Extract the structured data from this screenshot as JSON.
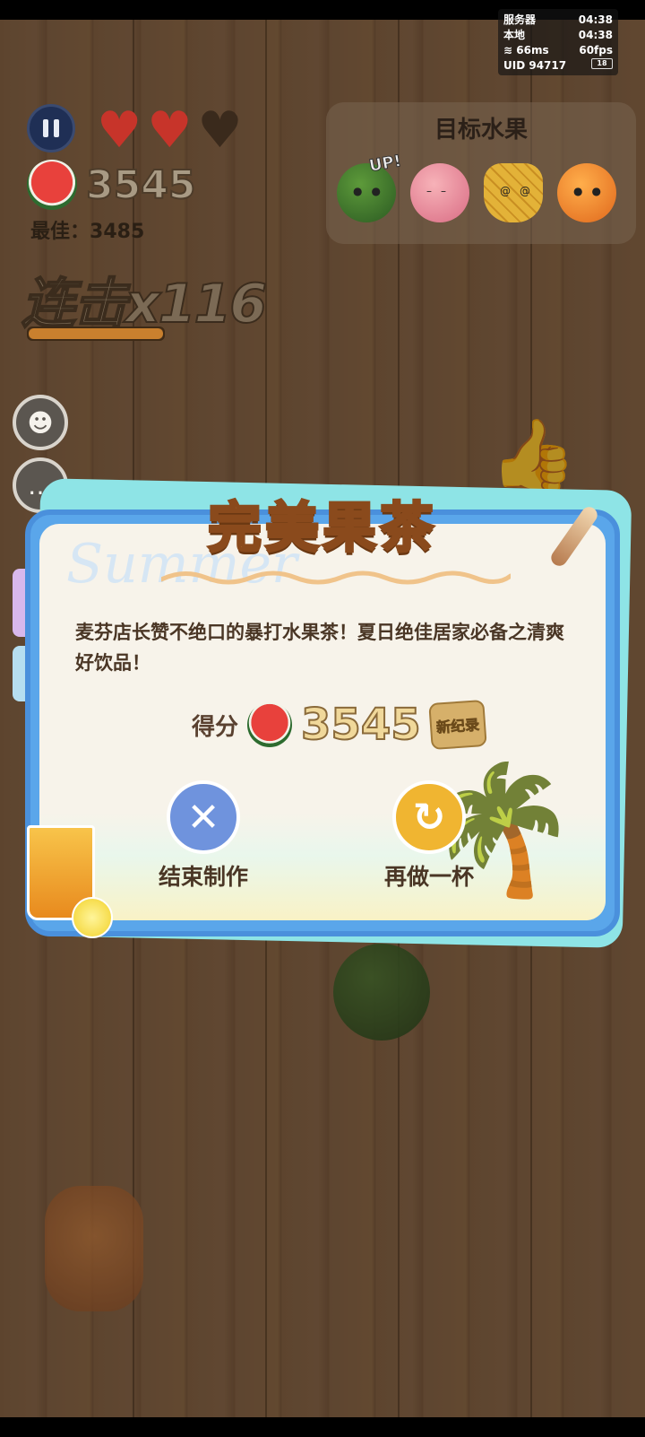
{
  "hud": {
    "server_label": "服务器",
    "server_time": "04:38",
    "local_label": "本地",
    "local_time": "04:38",
    "ping": "66ms",
    "fps": "60fps",
    "uid_label": "UID",
    "uid": "94717",
    "battery": "18"
  },
  "game": {
    "lives_total": 3,
    "lives_remaining": 2,
    "score": "3545",
    "best_label": "最佳：",
    "best": "3485",
    "combo": "连击x116",
    "combo_progress": 1.0
  },
  "target": {
    "title": "目标水果",
    "up_tag": "UP!",
    "fruits": [
      "watermelon",
      "peach",
      "pineapple",
      "orange"
    ]
  },
  "modal": {
    "title": "完美果茶",
    "decor_text": "Summer",
    "description": "麦芬店长赞不绝口的暴打水果茶！夏日绝佳居家必备之清爽好饮品！",
    "score_label": "得分",
    "score": "3545",
    "record_badge": "新纪录",
    "end_button": "结束制作",
    "retry_button": "再做一杯"
  },
  "colors": {
    "modal_frame": "#5aa6ea",
    "title_fill": "#f5c04a",
    "end_button": "#6f93dd",
    "retry_button": "#f0b531"
  },
  "icons": {
    "pause": "pause-icon",
    "robot": "robot-icon",
    "chat": "chat-bubble-icon",
    "thumbs_up": "thumbs-up-icon",
    "close": "close-icon",
    "retry": "retry-icon"
  }
}
